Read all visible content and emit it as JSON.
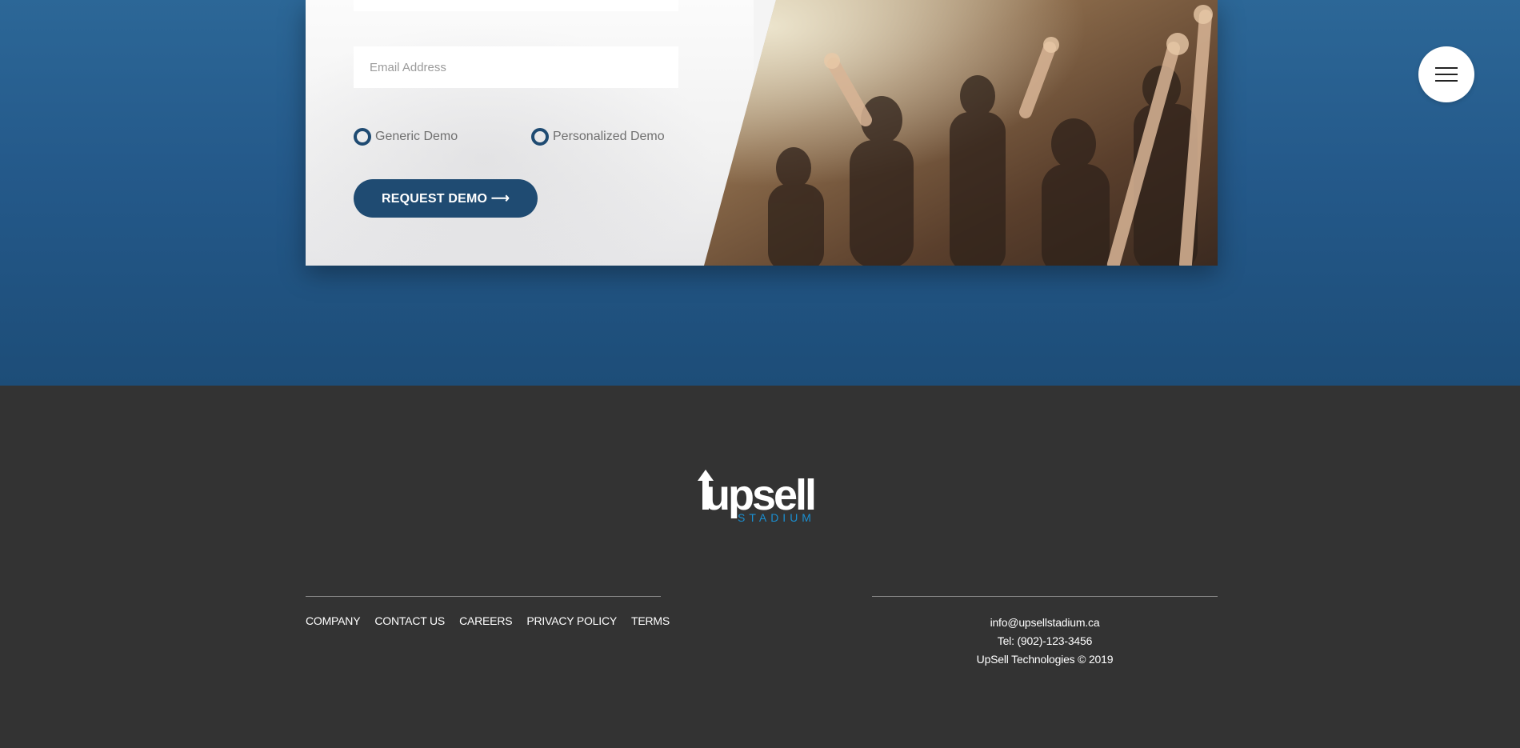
{
  "form": {
    "email_placeholder": "Email Address",
    "radio_options": [
      "Generic Demo",
      "Personalized Demo"
    ],
    "submit_label": "REQUEST DEMO ⟶"
  },
  "menu": {
    "icon": "hamburger-menu-icon"
  },
  "footer": {
    "logo": {
      "word_main": "upsell",
      "word_sub": "STADIUM"
    },
    "links": [
      "COMPANY",
      "CONTACT US",
      "CAREERS",
      "PRIVACY POLICY",
      "TERMS"
    ],
    "contact": {
      "email": "info@upsellstadium.ca",
      "phone": "Tel: (902)-123-3456",
      "copyright": "UpSell Technologies © 2019"
    }
  },
  "colors": {
    "hero_bg": "#24598a",
    "footer_bg": "#333333",
    "accent": "#1f4b72",
    "logo_blue": "#1a8fd1"
  }
}
